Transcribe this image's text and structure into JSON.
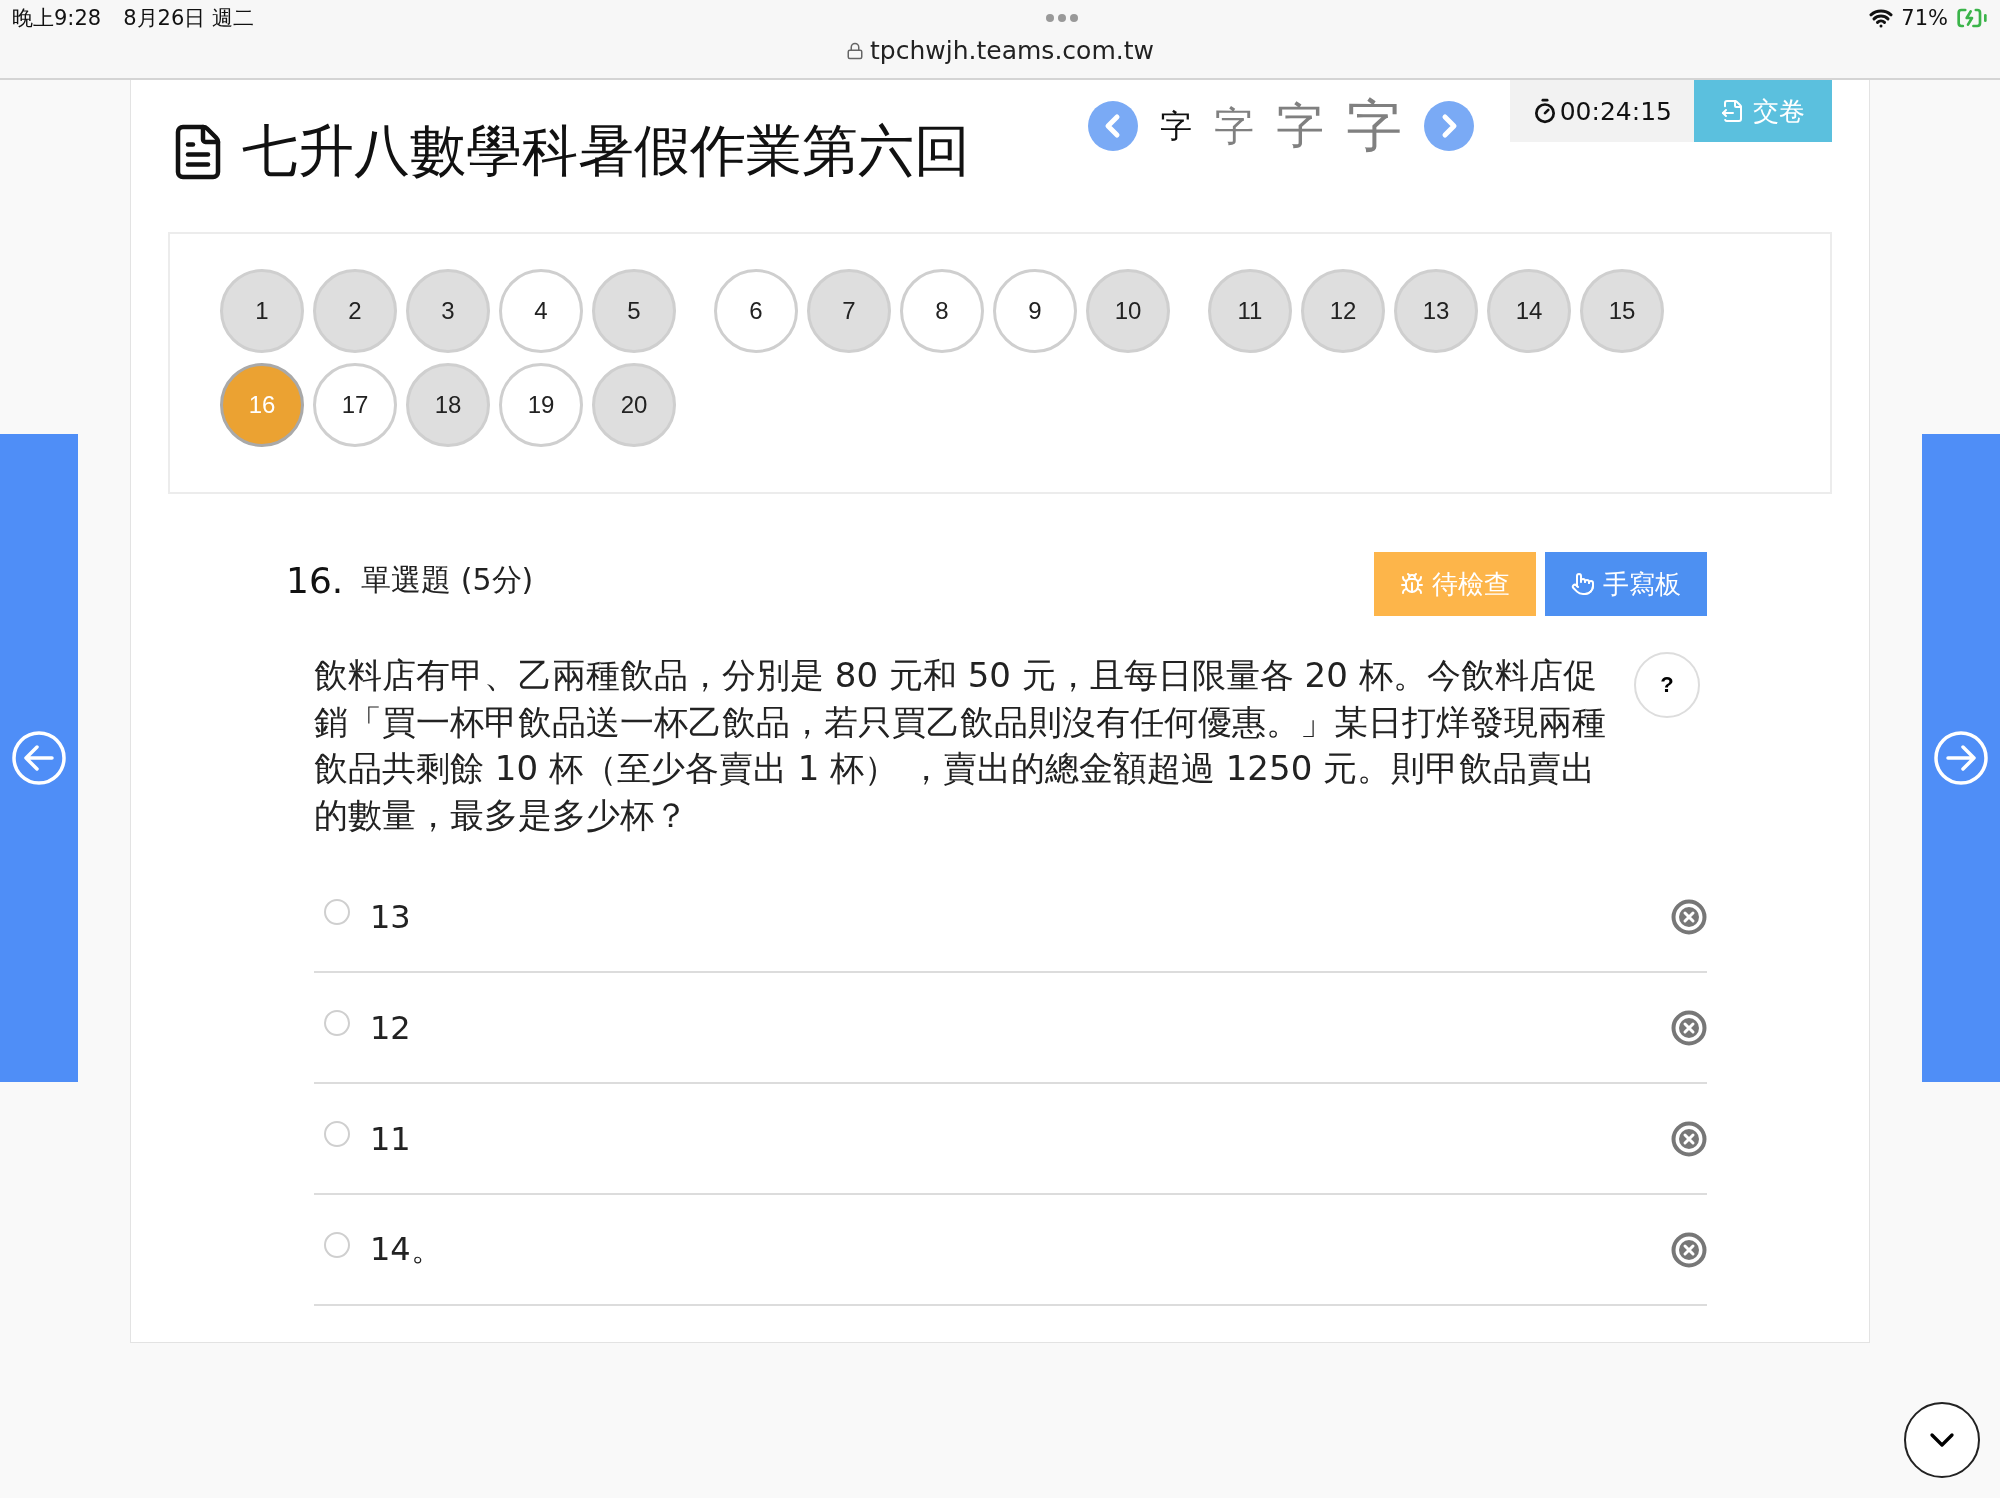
{
  "status_bar": {
    "time": "晚上9:28",
    "date": "8月26日 週二",
    "battery": "71%"
  },
  "browser": {
    "url": "tpchwjh.teams.com.tw"
  },
  "header": {
    "title": "七升八數學科暑假作業第六回",
    "font_sizes": [
      {
        "label": "字",
        "selected": true
      },
      {
        "label": "字",
        "selected": false
      },
      {
        "label": "字",
        "selected": false
      },
      {
        "label": "字",
        "selected": false
      }
    ],
    "timer": "00:24:15",
    "submit": "交卷"
  },
  "question_nav": [
    {
      "label": "1",
      "answered": true,
      "selected": false
    },
    {
      "label": "2",
      "answered": true,
      "selected": false
    },
    {
      "label": "3",
      "answered": true,
      "selected": false
    },
    {
      "label": "4",
      "answered": false,
      "selected": false
    },
    {
      "label": "5",
      "answered": true,
      "selected": false
    },
    {
      "label": "6",
      "answered": false,
      "selected": false
    },
    {
      "label": "7",
      "answered": true,
      "selected": false
    },
    {
      "label": "8",
      "answered": false,
      "selected": false
    },
    {
      "label": "9",
      "answered": false,
      "selected": false
    },
    {
      "label": "10",
      "answered": true,
      "selected": false
    },
    {
      "label": "11",
      "answered": true,
      "selected": false
    },
    {
      "label": "12",
      "answered": true,
      "selected": false
    },
    {
      "label": "13",
      "answered": true,
      "selected": false
    },
    {
      "label": "14",
      "answered": true,
      "selected": false
    },
    {
      "label": "15",
      "answered": true,
      "selected": false
    },
    {
      "label": "16",
      "selected": true
    },
    {
      "label": "17",
      "answered": false,
      "selected": false
    },
    {
      "label": "18",
      "answered": true,
      "selected": false
    },
    {
      "label": "19",
      "answered": false,
      "selected": false
    },
    {
      "label": "20",
      "answered": true,
      "selected": false
    }
  ],
  "question": {
    "number": "16.",
    "type": "單選題 (5分)",
    "buttons": [
      {
        "label": "待檢查",
        "kind": "review"
      },
      {
        "label": "手寫板",
        "kind": "handwriting"
      }
    ],
    "help": "?",
    "text": "飲料店有甲、乙兩種飲品，分別是 80 元和 50 元，且每日限量各 20 杯。今飲料店促銷「買一杯甲飲品送一杯乙飲品，若只買乙飲品則沒有任何優惠。」某日打烊發現兩種飲品共剩餘 10 杯（至少各賣出 1 杯） ，賣出的總金額超過 1250 元。則甲飲品賣出的數量，最多是多少杯？",
    "options": [
      {
        "label": "13",
        "selected": false
      },
      {
        "label": "12",
        "selected": false
      },
      {
        "label": "11",
        "selected": false
      },
      {
        "label": "14。",
        "selected": false
      }
    ]
  }
}
